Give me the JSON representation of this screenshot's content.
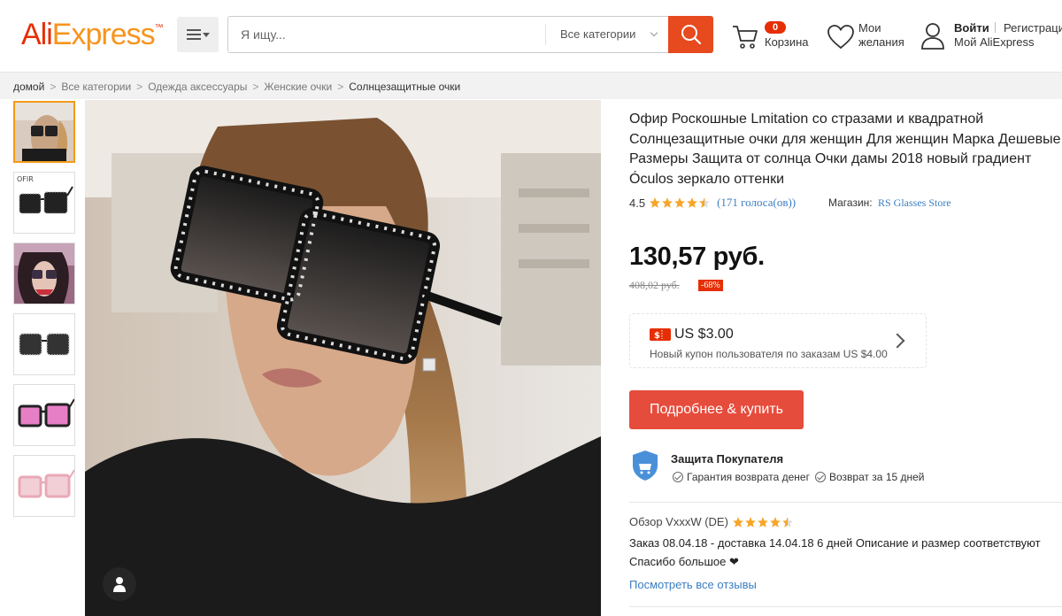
{
  "header": {
    "logo": {
      "ali": "Ali",
      "express": "Express"
    },
    "search": {
      "placeholder": "Я ищу...",
      "category": "Все категории"
    },
    "cart": {
      "count": "0",
      "label": "Корзина"
    },
    "wishlist": {
      "label_line1": "Мои",
      "label_line2": "желания"
    },
    "account": {
      "login": "Войти",
      "register": "Регистрация",
      "my": "Мой AliExpress"
    }
  },
  "breadcrumb": [
    "домой",
    "Все категории",
    "Одежда аксессуары",
    "Женские очки",
    "Солнцезащитные очки"
  ],
  "thumbnails": [
    {
      "name": "thumb-model-1"
    },
    {
      "name": "thumb-black-glasses-ofir",
      "label": "OFIR"
    },
    {
      "name": "thumb-model-2"
    },
    {
      "name": "thumb-black-glasses"
    },
    {
      "name": "thumb-pink-lens-glasses"
    },
    {
      "name": "thumb-pink-frame-glasses"
    }
  ],
  "product": {
    "title": "Офир Роскошные Lmitation со стразами и квадратной Солнцезащитные очки для женщин Для женщин Марка Дешевые Размеры Защита от солнца Очки дамы 2018 новый градиент Óculos зеркало оттенки",
    "rating": "4.5",
    "rating_value": 4.5,
    "votes": "(171 голоса(ов))",
    "store_label": "Магазин:",
    "store_name": "RS Glasses Store",
    "price": "130,57 руб.",
    "old_price": "408,02 руб.",
    "discount": "-68%",
    "coupon": {
      "amount": "US $3.00",
      "desc": "Новый купон пользователя по заказам US $4.00"
    },
    "buy_label": "Подробнее & купить",
    "protection": {
      "title": "Защита Покупателя",
      "items": [
        "Гарантия возврата денег",
        "Возврат за 15 дней"
      ]
    },
    "review": {
      "header": "Обзор VxxxW (DE)",
      "stars": 4.5,
      "text": "Заказ 08.04.18 - доставка 14.04.18 6 дней Описание и размер соответствуют Спасибо большое ❤",
      "more": "Посмотреть все отзывы"
    }
  },
  "colors": {
    "brand_red": "#e62e04",
    "brand_orange": "#f7941d",
    "button": "#e64c3c",
    "link": "#3b7ec2",
    "star": "#f7a528"
  }
}
